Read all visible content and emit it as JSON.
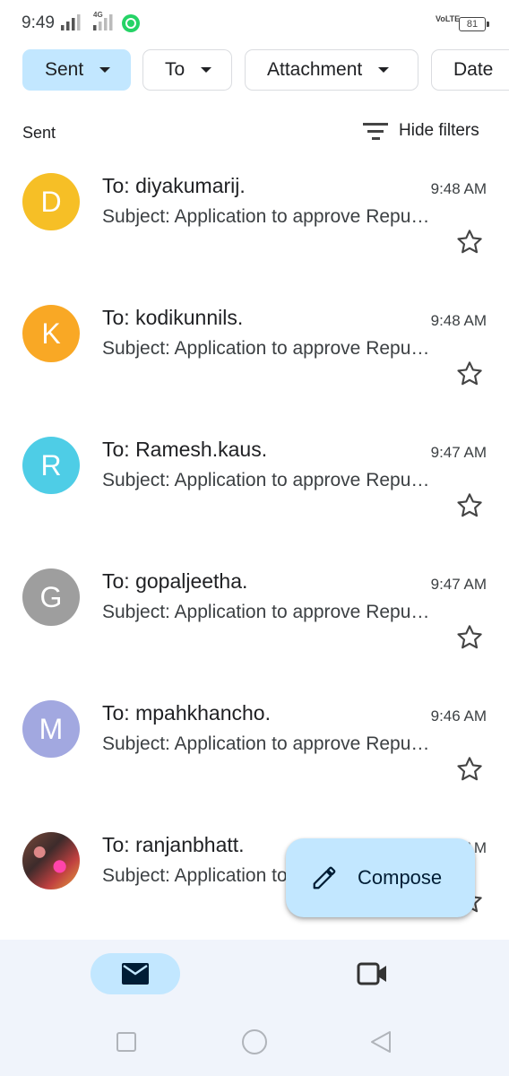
{
  "status_bar": {
    "time": "9:49",
    "network_left": "",
    "network_right": "4G",
    "volte": "VoLTE",
    "battery": "81",
    "icons": [
      "signal-icon",
      "signal-icon",
      "whatsapp-icon",
      "volte-icon",
      "battery-icon"
    ]
  },
  "filters": {
    "sent": "Sent",
    "to": "To",
    "attachment": "Attachment",
    "date": "Date"
  },
  "section_label": "Sent",
  "hide_filters": "Hide filters",
  "emails": [
    {
      "initial": "D",
      "avatar_color": "#f6bf26",
      "recipient": "To: diyakumarij.",
      "time": "9:48 AM",
      "subject": "Subject: Application to approve Republic Day leave"
    },
    {
      "initial": "K",
      "avatar_color": "#f9a825",
      "recipient": "To: kodikunnils.",
      "time": "9:48 AM",
      "subject": "Subject: Application to approve Republic Day leave"
    },
    {
      "initial": "R",
      "avatar_color": "#4ecde6",
      "recipient": "To: Ramesh.kaus.",
      "time": "9:47 AM",
      "subject": "Subject: Application to approve Republic Day leave"
    },
    {
      "initial": "G",
      "avatar_color": "#9e9e9e",
      "recipient": "To: gopaljeetha.",
      "time": "9:47 AM",
      "subject": "Subject: Application to approve Republic Day leave"
    },
    {
      "initial": "M",
      "avatar_color": "#a2a8e0",
      "recipient": "To: mpahkhancho.",
      "time": "9:46 AM",
      "subject": "Subject: Application to approve Republic Day leave"
    },
    {
      "initial": "",
      "avatar_color": "",
      "recipient": "To: ranjanbhatt.",
      "time": "9:46 AM",
      "subject": "Subject: Application to approve Republic Day leave"
    }
  ],
  "compose_label": "Compose",
  "nav": {
    "mail_icon": "mail-icon",
    "meet_icon": "video-camera-icon"
  },
  "system_nav": [
    "recents-icon",
    "home-icon",
    "back-icon"
  ]
}
